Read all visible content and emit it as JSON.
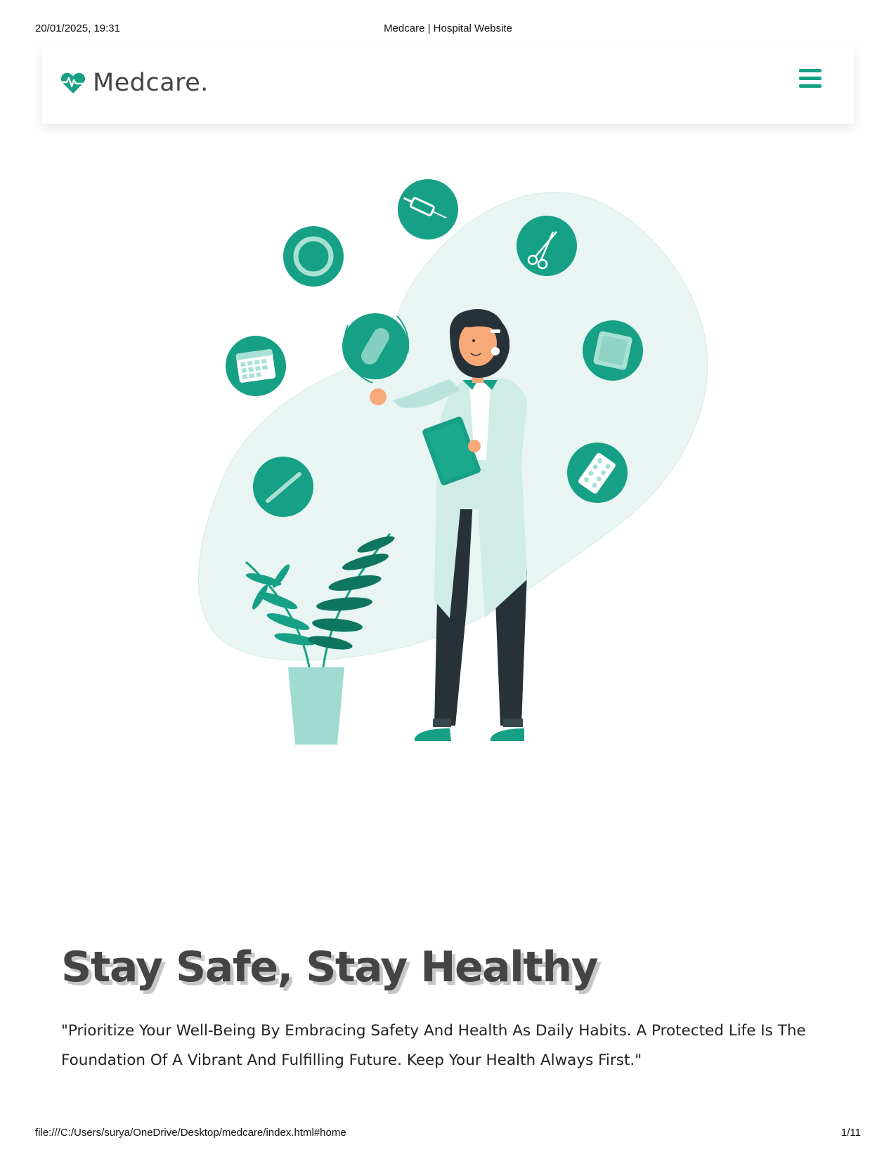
{
  "print_header": {
    "datetime": "20/01/2025, 19:31",
    "document_title": "Medcare | Hospital Website"
  },
  "print_footer": {
    "url": "file:///C:/Users/surya/OneDrive/Desktop/medcare/index.html#home",
    "page_number": "1/11"
  },
  "navbar": {
    "logo_icon": "heartbeat-icon",
    "logo_text": "Medcare.",
    "menu_icon": "hamburger-menu-icon"
  },
  "hero": {
    "illustration": "doctor-illustration",
    "title": "Stay Safe, Stay Healthy",
    "text": "\"Prioritize Your Well-Being By Embracing Safety And Health As Daily Habits. A Protected Life Is The Foundation Of A Vibrant And Fulfilling Future. Keep Your Health Always First.\""
  },
  "colors": {
    "accent": "#16a085",
    "heading": "#444444",
    "blob": "#e8f5f2",
    "pot": "#a0dbd1",
    "pants": "#263238"
  }
}
